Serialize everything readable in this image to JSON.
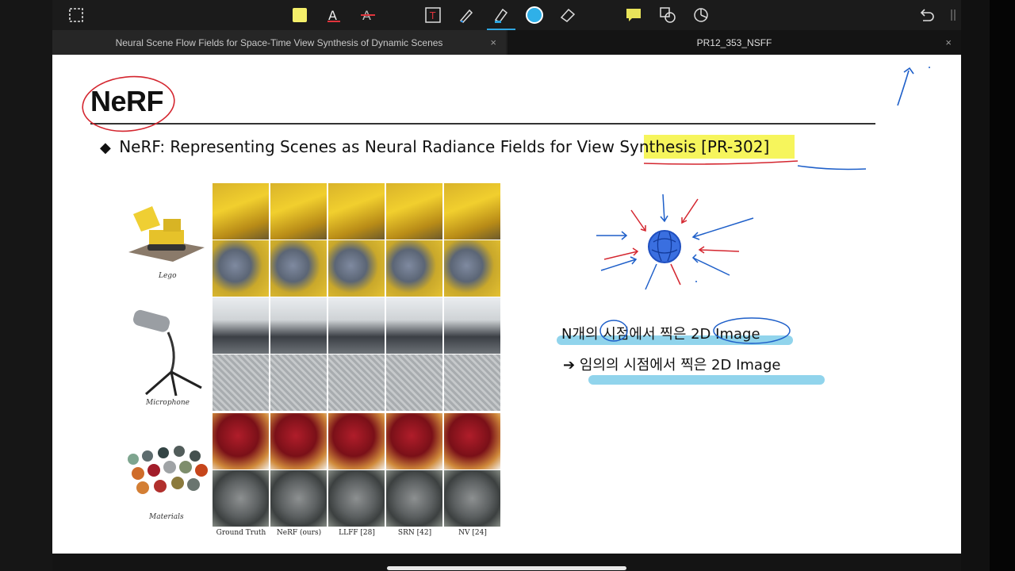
{
  "toolbar": {
    "tools": [
      {
        "name": "lasso-select-icon",
        "active": false
      },
      {
        "name": "sticky-note-icon",
        "active": false
      },
      {
        "name": "text-red-icon",
        "active": false
      },
      {
        "name": "text-strike-icon",
        "active": false
      },
      {
        "name": "text-box-icon",
        "active": false
      },
      {
        "name": "pen-icon",
        "active": false
      },
      {
        "name": "highlighter-icon",
        "active": true
      },
      {
        "name": "color-picker-icon",
        "active": false
      },
      {
        "name": "eraser-icon",
        "active": false
      },
      {
        "name": "comment-icon",
        "active": false
      },
      {
        "name": "shapes-icon",
        "active": false
      },
      {
        "name": "pie-icon",
        "active": false
      },
      {
        "name": "undo-icon",
        "active": false
      }
    ],
    "accent_color": "#2fa6e0"
  },
  "tabs": [
    {
      "label": "Neural Scene Flow Fields for Space-Time View Synthesis of Dynamic Scenes",
      "active": false,
      "close": "×"
    },
    {
      "label": "PR12_353_NSFF",
      "active": true,
      "close": "×"
    }
  ],
  "slide": {
    "title": "NeRF",
    "subtitle_bullet": "◆",
    "subtitle": "NeRF: Representing Scenes as Neural Radiance Fields for View Synthesis [PR-302]",
    "row_labels": [
      "Lego",
      "Microphone",
      "Materials"
    ],
    "column_labels": [
      "Ground Truth",
      "NeRF (ours)",
      "LLFF [28]",
      "SRN [42]",
      "NV [24]"
    ],
    "note_line1": "N개의 시점에서 찍은 2D Image",
    "note_line2_arrow": "➔",
    "note_line2": "임의의 시점에서 찍은 2D Image"
  },
  "annotation_colors": {
    "red_pen": "#d4262f",
    "blue_pen": "#1e5fc9",
    "yellow_highlight": "#f2f23a",
    "cyan_highlight": "#6cc6e6"
  }
}
